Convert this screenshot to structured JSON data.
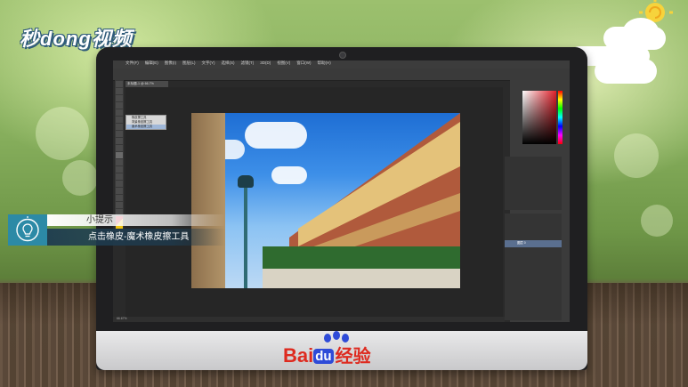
{
  "brand": {
    "video_logo": "秒dong视频",
    "baidu_logo_bai": "Bai",
    "baidu_logo_du": "du",
    "baidu_logo_jingyan": "经验"
  },
  "tip": {
    "title": "小提示",
    "text": "点击橡皮-魔术橡皮擦工具"
  },
  "photoshop": {
    "menu": [
      "文件(F)",
      "编辑(E)",
      "图像(I)",
      "图层(L)",
      "文字(Y)",
      "选择(S)",
      "滤镜(T)",
      "3D(D)",
      "视图(V)",
      "窗口(W)",
      "帮助(H)"
    ],
    "doc_tab": "未标题-1 @ 66.7%",
    "context_menu": [
      "橡皮擦工具",
      "背景橡皮擦工具",
      "魔术橡皮擦工具"
    ],
    "status_zoom": "66.67%",
    "layer_name": "图层 0"
  },
  "colors": {
    "tip_accent": "#2c8aa6",
    "baidu_red": "#de2a1f",
    "baidu_blue": "#2e4bd8"
  }
}
